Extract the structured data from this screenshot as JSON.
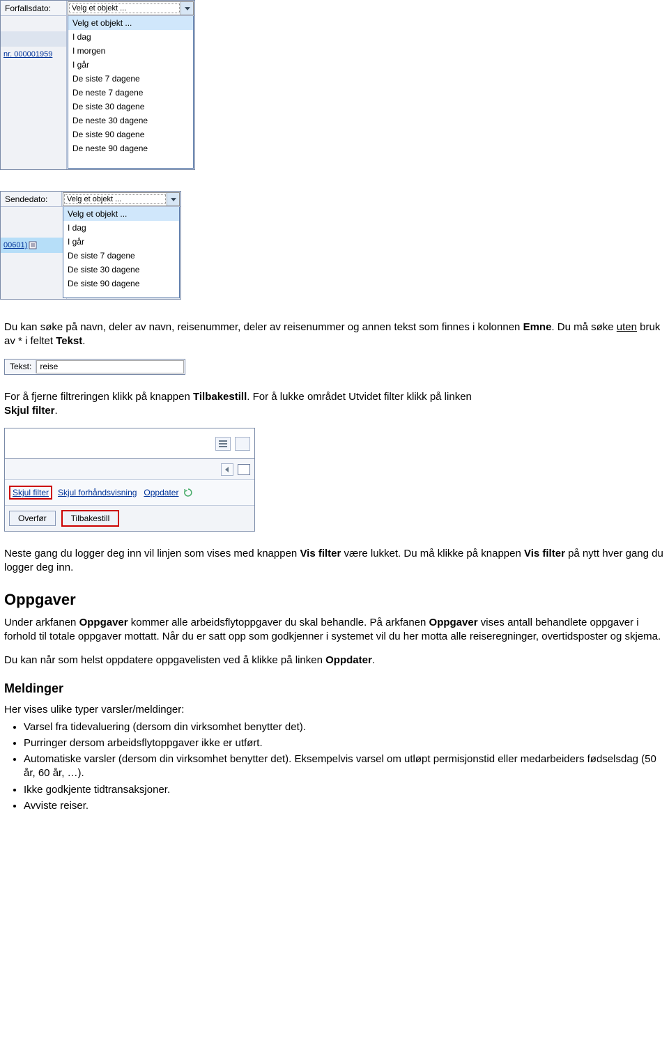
{
  "dropdown1": {
    "label": "Forfallsdato:",
    "selected": "Velg et objekt ...",
    "sidecell": "nr. 000001959",
    "items": [
      "Velg et objekt ...",
      "I dag",
      "I morgen",
      "I går",
      "De siste 7 dagene",
      "De neste 7 dagene",
      "De siste 30 dagene",
      "De neste 30 dagene",
      "De siste 90 dagene",
      "De neste 90 dagene"
    ]
  },
  "dropdown2": {
    "label": "Sendedato:",
    "selected": "Velg et objekt ...",
    "sidecell": "00601)",
    "items": [
      "Velg et objekt ...",
      "I dag",
      "I går",
      "De siste 7 dagene",
      "De siste 30 dagene",
      "De siste 90 dagene"
    ]
  },
  "para1": {
    "t1": "Du kan søke på navn, deler av navn, reisenummer, deler av reisenummer og annen tekst som finnes i kolonnen ",
    "b1": "Emne",
    "t2": ". Du må søke ",
    "u1": "uten",
    "t3": " bruk av * i feltet ",
    "b2": "Tekst",
    "t4": "."
  },
  "tekst": {
    "label": "Tekst:",
    "value": "reise"
  },
  "para2": {
    "t1": "For å fjerne filtreringen klikk på knappen ",
    "b1": "Tilbakestill",
    "t2": ". For å lukke området Utvidet filter klikk på linken ",
    "b2": "Skjul filter",
    "t3": "."
  },
  "filterwidget": {
    "links": {
      "skjul": "Skjul filter",
      "forhands": "Skjul forhåndsvisning",
      "oppdater": "Oppdater"
    },
    "buttons": {
      "overfor": "Overfør",
      "tilbakestill": "Tilbakestill"
    }
  },
  "para3": {
    "t1": "Neste gang du logger deg inn vil linjen som vises med knappen ",
    "b1": "Vis filter",
    "t2": " være lukket. Du må klikke på knappen ",
    "b2": "Vis filter",
    "t3": " på nytt hver gang du logger deg inn."
  },
  "oppgaver": {
    "heading": "Oppgaver",
    "p1a": "Under arkfanen ",
    "p1b": "Oppgaver",
    "p1c": " kommer alle arbeidsflytoppgaver du skal behandle. På arkfanen ",
    "p1d": "Oppgaver",
    "p1e": " vises antall behandlete oppgaver i forhold til totale oppgaver mottatt. Når du er satt opp som godkjenner i systemet vil du her motta alle reiseregninger, overtidsposter og skjema.",
    "p2a": "Du kan når som helst oppdatere oppgavelisten ved å klikke på linken ",
    "p2b": "Oppdater",
    "p2c": "."
  },
  "meldinger": {
    "heading": "Meldinger",
    "intro": "Her vises ulike typer varsler/meldinger:",
    "items": [
      "Varsel fra tidevaluering (dersom din virksomhet benytter det).",
      "Purringer dersom arbeidsflytoppgaver ikke er utført.",
      "Automatiske varsler (dersom din virksomhet benytter det). Eksempelvis varsel om utløpt permisjonstid eller medarbeiders fødselsdag (50 år, 60 år, …).",
      "Ikke godkjente tidtransaksjoner.",
      "Avviste reiser."
    ]
  }
}
